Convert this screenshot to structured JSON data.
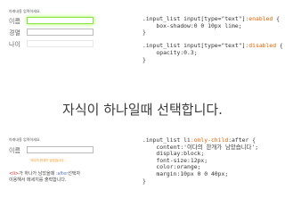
{
  "form_top": {
    "hint": "아래내용 입력하세요.",
    "rows": [
      {
        "label": "이름"
      },
      {
        "label": "경멸"
      },
      {
        "label": "나이"
      }
    ]
  },
  "code_top": {
    "line1_sel": ".input_list input[type=\"text\"]",
    "line1_pseudo": ":enabled",
    "line1_brace": " {",
    "line2": "    box-shadow:0 0 10px lime;",
    "line3": "}",
    "line4_sel": ".input_list input[type=\"text\"]",
    "line4_pseudo": ":disabled",
    "line4_brace": " {",
    "line5": "    opacity:0.3;",
    "line6": "}"
  },
  "heading": "자식이 하나일때 선택합니다.",
  "form_bottom": {
    "hint": "아래내용 입력하세요.",
    "label": "이름",
    "warning": "이다의 한개가 남았습니다."
  },
  "code_bottom": {
    "line1_sel": ".input_list li",
    "line1_pseudo": ":only-child",
    "line1_rest": ":after {",
    "line2": "    content:'이다의 한개가 남았습니다';",
    "line3": "    display:block;",
    "line4": "    font-size:12px;",
    "line5": "    color:orange;",
    "line6": "    margin:10px 0 0 40px;",
    "line7": "}"
  },
  "caption": {
    "tag": "<li>",
    "part1": "가 하나가 남았을때 ",
    "pseudo": ":after",
    "part2": "선택자",
    "line2": "이용해서 메세지를 출력합니다."
  },
  "colors": {
    "glow": "#9cff4a",
    "pseudo": "#e06000",
    "warning": "#ff8800",
    "tag": "#cc2222"
  }
}
